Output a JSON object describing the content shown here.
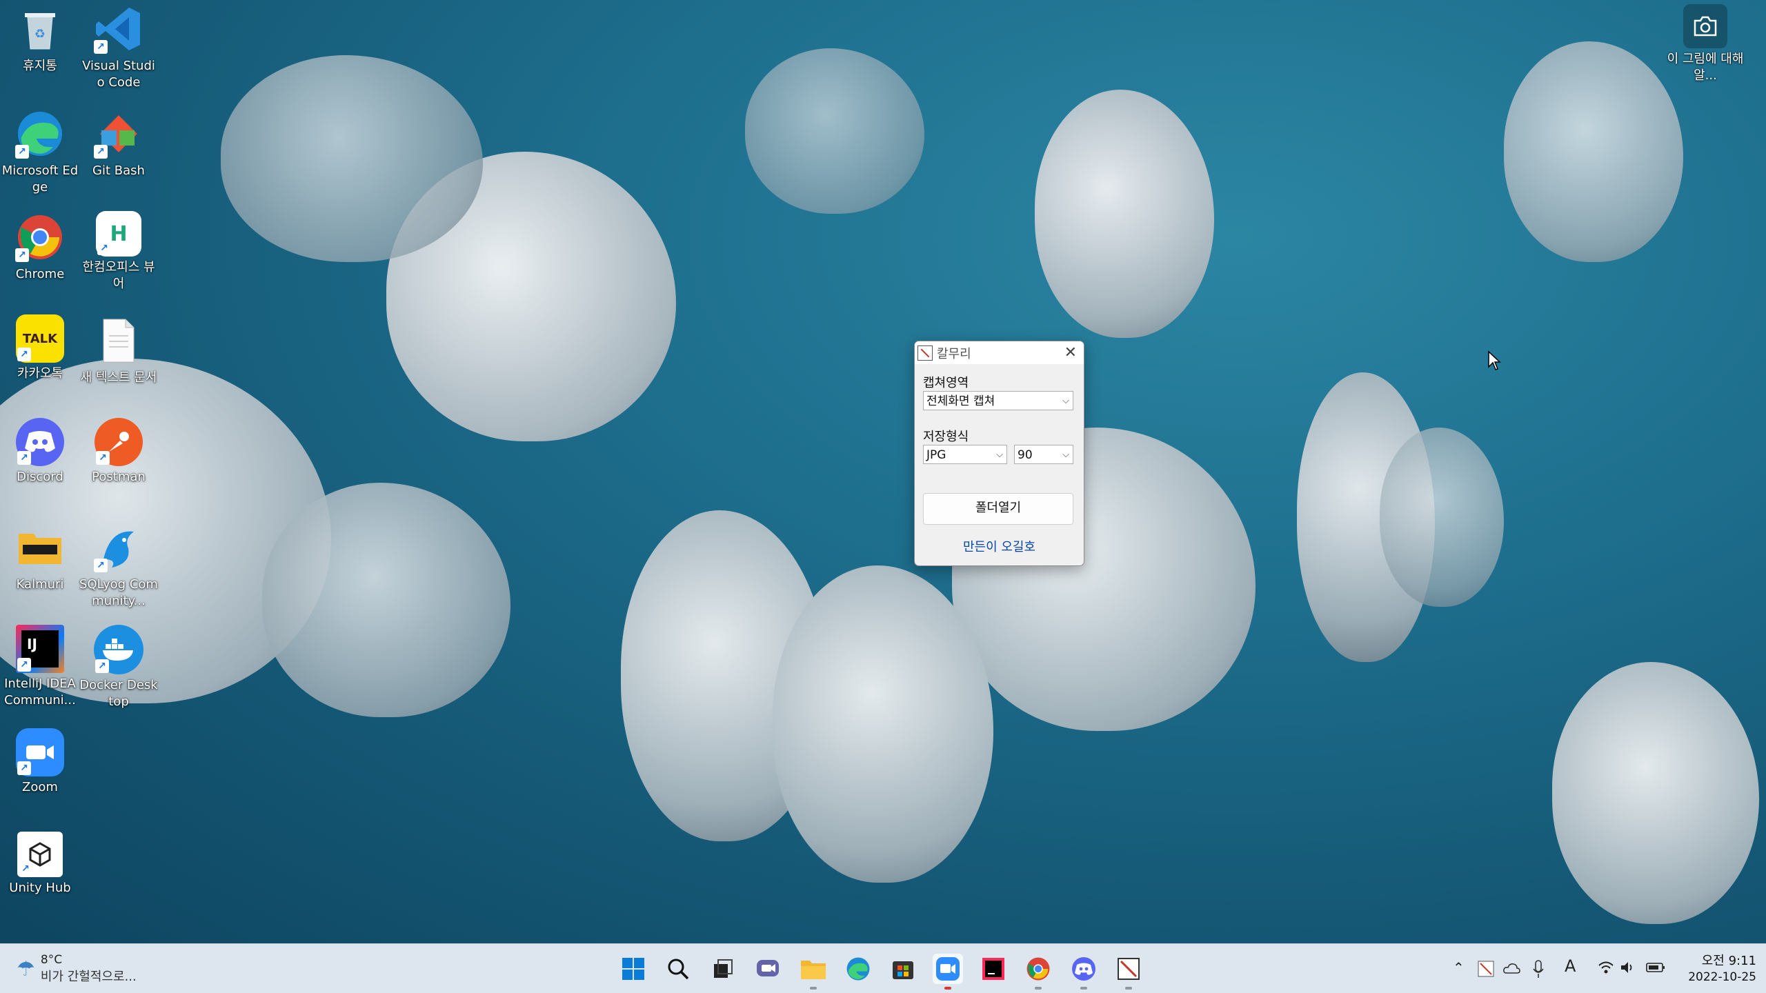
{
  "desktop": {
    "icons": [
      {
        "label": "휴지통",
        "name": "recycle-bin-icon"
      },
      {
        "label": "Visual Studio Code",
        "name": "vscode-icon"
      },
      {
        "label": "Microsoft Edge",
        "name": "edge-icon"
      },
      {
        "label": "Git Bash",
        "name": "git-bash-icon"
      },
      {
        "label": "Chrome",
        "name": "chrome-icon"
      },
      {
        "label": "한컴오피스 뷰어",
        "name": "hancom-viewer-icon"
      },
      {
        "label": "카카오톡",
        "name": "kakaotalk-icon"
      },
      {
        "label": "새 텍스트 문서",
        "name": "text-document-icon"
      },
      {
        "label": "Discord",
        "name": "discord-icon"
      },
      {
        "label": "Postman",
        "name": "postman-icon"
      },
      {
        "label": "Kalmuri",
        "name": "kalmuri-icon"
      },
      {
        "label": "SQLyog Community...",
        "name": "sqlyog-icon"
      },
      {
        "label": "IntelliJ IDEA Communi...",
        "name": "intellij-icon"
      },
      {
        "label": "Docker Desktop",
        "name": "docker-icon"
      },
      {
        "label": "Zoom",
        "name": "zoom-icon"
      },
      {
        "label": "Unity Hub",
        "name": "unity-hub-icon"
      }
    ],
    "spotlight_label": "이 그림에 대해 알...",
    "glyphs": {
      "talk": "TALK",
      "ij": "IJ",
      "hewer": "H"
    }
  },
  "dialog": {
    "title": "칼무리",
    "capture_area_label": "캡쳐영역",
    "capture_area_value": "전체화면 캡쳐",
    "format_label": "저장형식",
    "format_value": "JPG",
    "quality_value": "90",
    "open_folder_label": "폴더열기",
    "author_link": "만든이 오길호"
  },
  "taskbar": {
    "weather_temp": "8°C",
    "weather_desc": "비가 간헐적으로...",
    "time": "오전 9:11",
    "date": "2022-10-25",
    "ime": "A"
  },
  "colors": {
    "accent": "#0645ad",
    "taskbar": "#dde6ee"
  }
}
